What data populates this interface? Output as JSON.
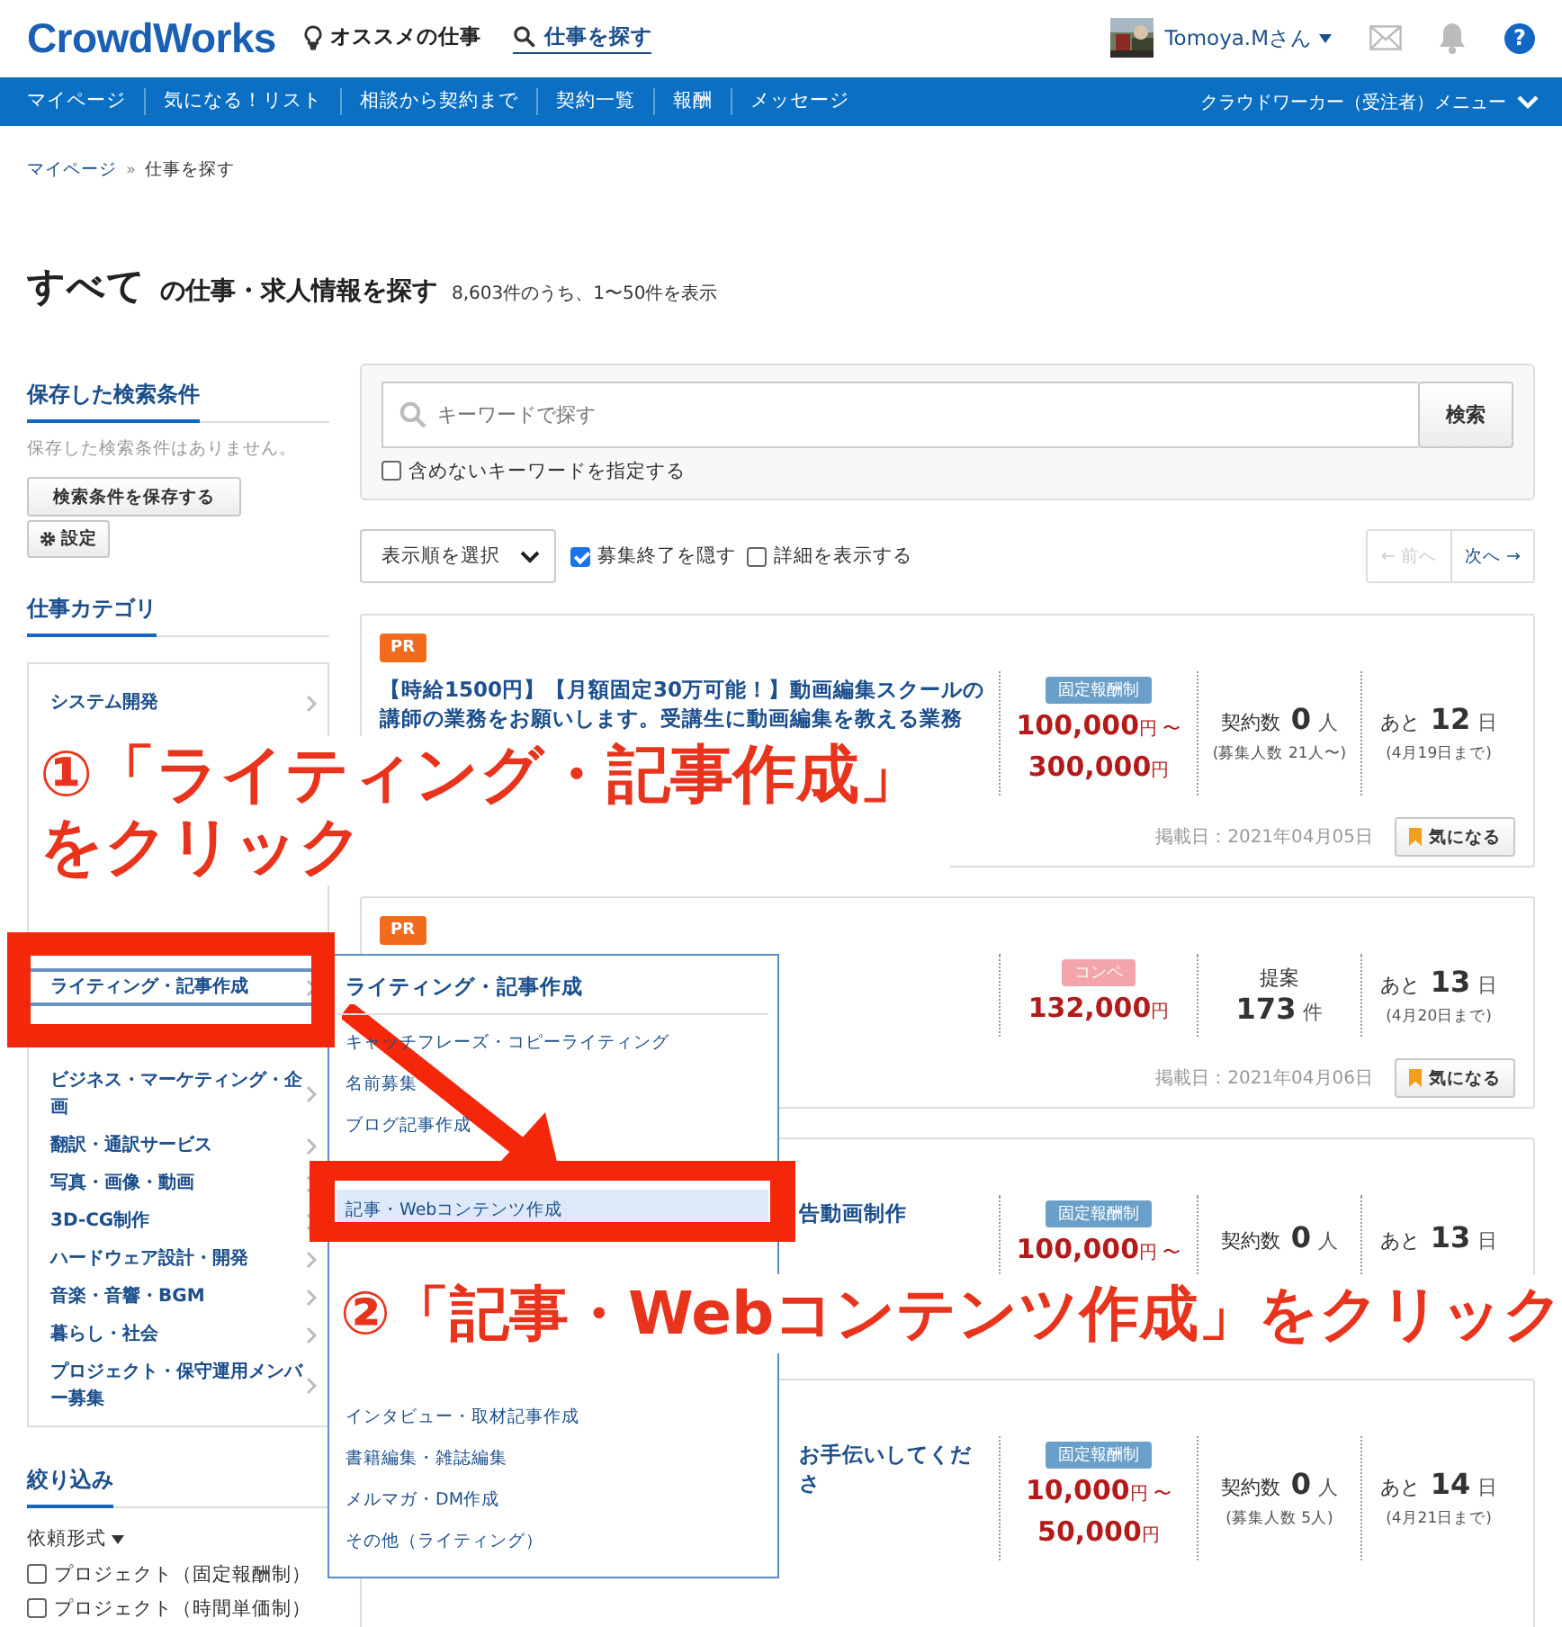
{
  "header": {
    "logo": "CrowdWorks",
    "links": [
      {
        "kind": "bulb",
        "label": "オススメの仕事",
        "selected": false
      },
      {
        "kind": "search",
        "label": "仕事を探す",
        "selected": true
      }
    ],
    "user": {
      "name": "Tomoya.Mさん"
    },
    "help": "?"
  },
  "nav": {
    "items": [
      "マイページ",
      "気になる！リスト",
      "相談から契約まで",
      "契約一覧",
      "報酬",
      "メッセージ"
    ],
    "menu": "クラウドワーカー（受注者）メニュー"
  },
  "breadcrumb": {
    "items": [
      "マイページ",
      "仕事を探す"
    ],
    "separator": "»"
  },
  "heading": {
    "category": "すべて",
    "title": "の仕事・求人情報を探す",
    "count": "8,603件のうち、1〜50件を表示"
  },
  "sidebar": {
    "saved": {
      "title": "保存した検索条件",
      "note": "保存した検索条件はありません。",
      "save_button": "検索条件を保存する",
      "settings_button": "設定"
    },
    "categories": {
      "title": "仕事カテゴリ",
      "groups": [
        [
          {
            "label": "システム開発",
            "selected": false
          }
        ],
        [
          {
            "label": "ライティング・記事作成",
            "selected": true
          }
        ],
        [
          {
            "label": "ビジネス・マーケティング・企画",
            "selected": false
          },
          {
            "label": "翻訳・通訳サービス",
            "selected": false
          },
          {
            "label": "写真・画像・動画",
            "selected": false
          },
          {
            "label": "3D-CG制作",
            "selected": false
          },
          {
            "label": "ハードウェア設計・開発",
            "selected": false
          },
          {
            "label": "音楽・音響・BGM",
            "selected": false
          },
          {
            "label": "暮らし・社会",
            "selected": false
          },
          {
            "label": "プロジェクト・保守運用メンバー募集",
            "selected": false
          }
        ]
      ]
    },
    "filter": {
      "title": "絞り込み",
      "dropdown": "依頼形式",
      "options": [
        {
          "label": "プロジェクト（固定報酬制）",
          "checked": false
        },
        {
          "label": "プロジェクト（時間単価制）",
          "checked": false
        }
      ]
    }
  },
  "search": {
    "placeholder": "キーワードで探す",
    "button": "検索",
    "exclude": {
      "label": "含めないキーワードを指定する",
      "checked": false
    }
  },
  "toolbar": {
    "sort": "表示順を選択",
    "options": [
      {
        "label": "募集終了を隠す",
        "checked": true
      },
      {
        "label": "詳細を表示する",
        "checked": false
      }
    ],
    "prev": {
      "label": "← 前へ",
      "disabled": true
    },
    "next": {
      "label": "次へ →",
      "disabled": false
    }
  },
  "jobs": [
    {
      "kind": "full_title",
      "badge": "PR",
      "title": "【時給1500円】【月額固定30万可能！】動画編集スクールの講師の業務をお願いします。受講生に動画編集を教える業務",
      "pay_type": {
        "kind": "fixed",
        "label": "固定報酬制"
      },
      "prices": [
        {
          "amount": "100,000",
          "unit": "円 〜"
        },
        {
          "amount": "300,000",
          "unit": "円"
        }
      ],
      "stat": {
        "kind": "inline",
        "label": "契約数",
        "value": "0",
        "unit": "人",
        "note": "(募集人数 21人〜)"
      },
      "deadline": {
        "prefix": "あと",
        "value": "12",
        "unit": "日",
        "note": "(4月19日まで)"
      },
      "posted": "掲載日：2021年04月05日",
      "bookmark": "気になる"
    },
    {
      "kind": "full_title",
      "badge": "PR",
      "pay_type": {
        "kind": "competition",
        "label": "コンペ"
      },
      "prices": [
        {
          "amount": "132,000",
          "unit": "円"
        }
      ],
      "stat": {
        "kind": "stacked",
        "label": "提案",
        "value": "173",
        "unit": "件"
      },
      "deadline": {
        "prefix": "あと",
        "value": "13",
        "unit": "日",
        "note": "(4月20日まで)"
      },
      "posted": "掲載日：2021年04月06日",
      "bookmark": "気になる"
    },
    {
      "kind": "title_tail",
      "title": "告動画制作",
      "pay_type": {
        "kind": "fixed",
        "label": "固定報酬制"
      },
      "prices": [
        {
          "amount": "100,000",
          "unit": "円 〜"
        }
      ],
      "stat": {
        "kind": "inline",
        "label": "契約数",
        "value": "0",
        "unit": "人"
      },
      "deadline": {
        "prefix": "あと",
        "value": "13",
        "unit": "日"
      }
    },
    {
      "kind": "title_tail",
      "title": "お手伝いしてくださ",
      "pay_type": {
        "kind": "fixed",
        "label": "固定報酬制"
      },
      "prices": [
        {
          "amount": "10,000",
          "unit": "円 〜"
        },
        {
          "amount": "50,000",
          "unit": "円"
        }
      ],
      "stat": {
        "kind": "inline",
        "label": "契約数",
        "value": "0",
        "unit": "人",
        "note": "(募集人数 5人)"
      },
      "deadline": {
        "prefix": "あと",
        "value": "14",
        "unit": "日",
        "note": "(4月21日まで)"
      }
    }
  ],
  "dropdown": {
    "title": "ライティング・記事作成",
    "groups": [
      [
        {
          "label": "キャッチフレーズ・コピーライティング",
          "selected": false
        },
        {
          "label": "名前募集",
          "selected": false
        },
        {
          "label": "ブログ記事作成",
          "selected": false
        }
      ],
      [
        {
          "label": "記事・Webコンテンツ作成",
          "selected": true
        }
      ],
      [
        {
          "label": "インタビュー・取材記事作成",
          "selected": false
        },
        {
          "label": "書籍編集・雑誌編集",
          "selected": false
        },
        {
          "label": "メルマガ・DM作成",
          "selected": false
        },
        {
          "label": "その他（ライティング）",
          "selected": false
        }
      ]
    ]
  },
  "annotations": [
    {
      "kind": "first",
      "lines": [
        "①「ライティング・記事作成」",
        "をクリック"
      ]
    },
    {
      "kind": "second",
      "lines": [
        "②「記事・Webコンテンツ作成」をクリック"
      ]
    }
  ]
}
